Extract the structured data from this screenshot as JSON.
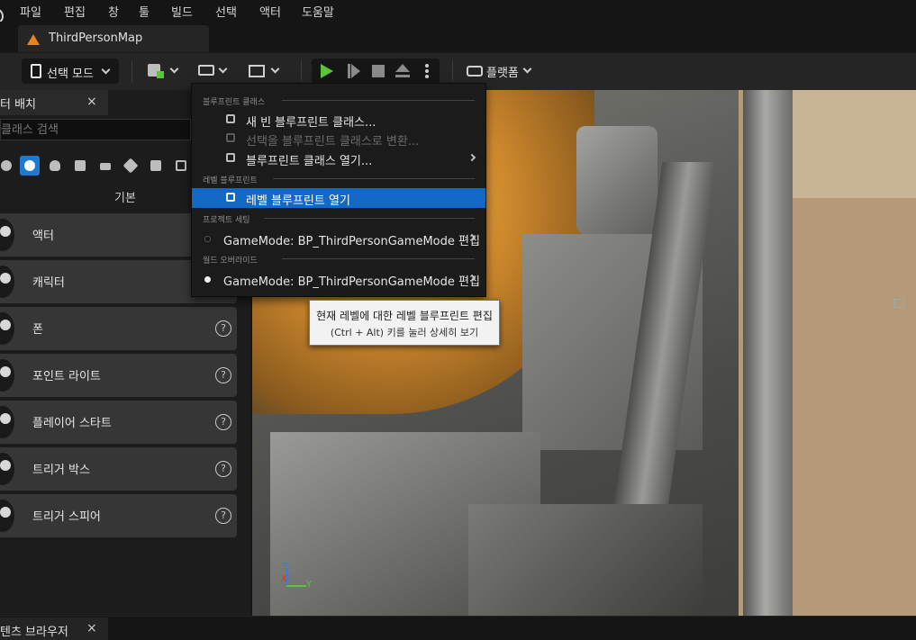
{
  "menubar": {
    "items": [
      "파일",
      "편집",
      "창",
      "툴",
      "빌드",
      "선택",
      "액터",
      "도움말"
    ]
  },
  "tabs": {
    "level_tab": "ThirdPersonMap"
  },
  "toolbar": {
    "select_mode_label": "선택 모드",
    "platform_label": "플랫폼",
    "play_color": "#5bc43d"
  },
  "place_actors": {
    "tab_label": "터 배치",
    "search_placeholder": "클래스 검색",
    "section_title": "기본",
    "active_category_color": "#1f7ad1",
    "items": [
      {
        "label": "액터",
        "icon": "sphere-icon",
        "help": false
      },
      {
        "label": "캐릭터",
        "icon": "character-icon",
        "help": false
      },
      {
        "label": "폰",
        "icon": "pawn-icon",
        "help": true
      },
      {
        "label": "포인트 라이트",
        "icon": "point-light-icon",
        "help": true
      },
      {
        "label": "플레이어 스타트",
        "icon": "player-start-icon",
        "help": true
      },
      {
        "label": "트리거 박스",
        "icon": "trigger-box-icon",
        "help": true
      },
      {
        "label": "트리거 스피어",
        "icon": "trigger-sphere-icon",
        "help": true
      }
    ],
    "help_glyph": "?"
  },
  "blueprint_menu": {
    "sections": {
      "blueprint_class": "블루프린트 클래스",
      "level_blueprint": "레벨 블루프린트",
      "project_settings": "프로젝트 세팅",
      "world_override": "월드 오버라이드"
    },
    "items": {
      "new_empty": "새 빈 블루프린트 클래스...",
      "convert_selection": "선택을 블루프린트 클래스로 변환...",
      "open_class": "블루프린트 클래스 열기...",
      "open_level_bp": "레벨 블루프린트 열기",
      "project_gamemode": "GameMode: BP_ThirdPersonGameMode 편집",
      "world_gamemode": "GameMode: BP_ThirdPersonGameMode 편집"
    },
    "highlight_color": "#1268c4"
  },
  "tooltip": {
    "line1": "현재 레벨에 대한 레벨 블루프린트 편집",
    "line2": "(Ctrl + Alt) 키를 눌러 상세히 보기"
  },
  "viewport": {
    "axis_x": "X",
    "axis_y": "Y",
    "axis_z": "Z"
  },
  "bottom": {
    "content_browser_tab": "텐츠 브라우저"
  },
  "close_glyph": "×"
}
